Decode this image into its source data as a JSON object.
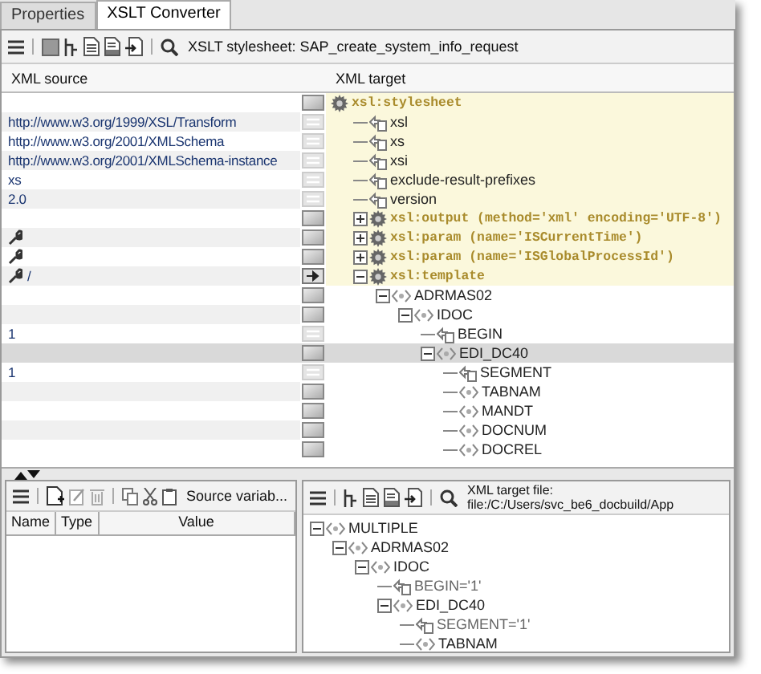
{
  "tabs": [
    {
      "label": "Properties",
      "selected": false
    },
    {
      "label": "XSLT Converter",
      "selected": true
    }
  ],
  "toolbar": {
    "label": "XSLT stylesheet: SAP_create_system_info_request"
  },
  "mapping": {
    "columns": [
      "XML source",
      "XML target"
    ],
    "tree": [
      {
        "label": "xsl:stylesheet",
        "kind": "xsl",
        "mapping": {
          "kind": "node"
        },
        "wrench": false,
        "selected": false,
        "children": [
          {
            "label": "xsl",
            "kind": "attr",
            "source": "http://www.w3.org/1999/XSL/Transform",
            "mapping": {
              "kind": "attr"
            },
            "wrench": false,
            "selected": false
          },
          {
            "label": "xs",
            "kind": "attr",
            "source": "http://www.w3.org/2001/XMLSchema",
            "mapping": {
              "kind": "attr"
            },
            "wrench": false,
            "selected": false
          },
          {
            "label": "xsi",
            "kind": "attr",
            "source": "http://www.w3.org/2001/XMLSchema-instance",
            "mapping": {
              "kind": "attr"
            },
            "wrench": false,
            "selected": false
          },
          {
            "label": "exclude-result-prefixes",
            "kind": "attr",
            "source": "xs",
            "mapping": {
              "kind": "attr"
            },
            "wrench": false,
            "selected": false
          },
          {
            "label": "version",
            "kind": "attr",
            "source": "2.0",
            "mapping": {
              "kind": "attr"
            },
            "wrench": false,
            "selected": false
          },
          {
            "label": "xsl:output (method='xml' encoding='UTF-8')",
            "kind": "xsl",
            "mapping": {
              "kind": "node"
            },
            "wrench": false,
            "selected": false,
            "expanded": false
          },
          {
            "label": "xsl:param (name='ISCurrentTime')",
            "kind": "xsl",
            "mapping": {
              "kind": "node"
            },
            "wrench": true,
            "selected": false,
            "expanded": false
          },
          {
            "label": "xsl:param (name='ISGlobalProcessId')",
            "kind": "xsl",
            "mapping": {
              "kind": "node"
            },
            "wrench": true,
            "selected": false,
            "expanded": false
          },
          {
            "label": "xsl:template",
            "kind": "xsl",
            "source": "/",
            "mapping": {
              "kind": "arrow"
            },
            "wrench": true,
            "selected": false,
            "expanded": true,
            "children": [
              {
                "label": "ADRMAS02",
                "kind": "element",
                "mapping": {
                  "kind": "node"
                },
                "wrench": false,
                "selected": false,
                "expanded": true,
                "children": [
                  {
                    "label": "IDOC",
                    "kind": "element",
                    "mapping": {
                      "kind": "node"
                    },
                    "wrench": false,
                    "selected": false,
                    "expanded": true,
                    "children": [
                      {
                        "label": "BEGIN",
                        "kind": "attr",
                        "source": "1",
                        "mapping": {
                          "kind": "attr"
                        },
                        "wrench": false,
                        "selected": false
                      },
                      {
                        "label": "EDI_DC40",
                        "kind": "element",
                        "mapping": {
                          "kind": "node"
                        },
                        "wrench": false,
                        "selected": true,
                        "expanded": true,
                        "children": [
                          {
                            "label": "SEGMENT",
                            "kind": "attr",
                            "source": "1",
                            "mapping": {
                              "kind": "attr"
                            },
                            "wrench": false,
                            "selected": false
                          },
                          {
                            "label": "TABNAM",
                            "kind": "element",
                            "mapping": {
                              "kind": "node"
                            },
                            "wrench": false,
                            "selected": false
                          },
                          {
                            "label": "MANDT",
                            "kind": "element",
                            "mapping": {
                              "kind": "node"
                            },
                            "wrench": false,
                            "selected": false
                          },
                          {
                            "label": "DOCNUM",
                            "kind": "element",
                            "mapping": {
                              "kind": "node"
                            },
                            "wrench": false,
                            "selected": false
                          },
                          {
                            "label": "DOCREL",
                            "kind": "element",
                            "mapping": {
                              "kind": "node"
                            },
                            "wrench": false,
                            "selected": false
                          }
                        ]
                      }
                    ]
                  }
                ]
              }
            ]
          }
        ]
      }
    ]
  },
  "variables": {
    "title": "Source variab...",
    "columns": [
      "Name",
      "Type",
      "Value"
    ]
  },
  "output": {
    "label": "XML target file: file:/C:/Users/svc_be6_docbuild/App",
    "tree": [
      {
        "label": "MULTIPLE",
        "kind": "element",
        "expanded": true,
        "children": [
          {
            "label": "ADRMAS02",
            "kind": "element",
            "expanded": true,
            "children": [
              {
                "label": "IDOC",
                "kind": "element",
                "expanded": true,
                "children": [
                  {
                    "label": "BEGIN='1'",
                    "kind": "attr"
                  },
                  {
                    "label": "EDI_DC40",
                    "kind": "element",
                    "expanded": true,
                    "children": [
                      {
                        "label": "SEGMENT='1'",
                        "kind": "attr"
                      },
                      {
                        "label": "TABNAM",
                        "kind": "element"
                      }
                    ]
                  }
                ]
              }
            ]
          }
        ]
      }
    ]
  }
}
